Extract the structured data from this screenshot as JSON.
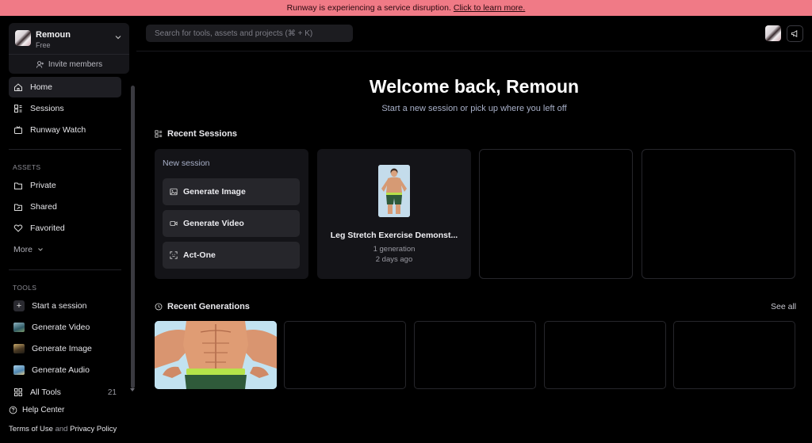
{
  "banner": {
    "text": "Runway is experiencing a service disruption.",
    "link": "Click to learn more."
  },
  "workspace": {
    "name": "Remoun",
    "plan": "Free",
    "invite_label": "Invite members"
  },
  "nav": [
    {
      "label": "Home",
      "icon": "home-icon",
      "active": true
    },
    {
      "label": "Sessions",
      "icon": "sessions-icon"
    },
    {
      "label": "Runway Watch",
      "icon": "tv-icon"
    }
  ],
  "assets": {
    "heading": "ASSETS",
    "items": [
      {
        "label": "Private",
        "icon": "folder-icon"
      },
      {
        "label": "Shared",
        "icon": "shared-folder-icon"
      },
      {
        "label": "Favorited",
        "icon": "heart-icon"
      }
    ],
    "more_label": "More"
  },
  "tools": {
    "heading": "TOOLS",
    "items": [
      {
        "label": "Start a session",
        "icon": "plus-icon"
      },
      {
        "label": "Generate Video",
        "icon": "video-thumb-icon",
        "color": "#4f7f8f"
      },
      {
        "label": "Generate Image",
        "icon": "image-thumb-icon",
        "color": "#6b5a3a"
      },
      {
        "label": "Generate Audio",
        "icon": "audio-thumb-icon",
        "color": "#5f8fb0"
      }
    ],
    "all_tools": {
      "label": "All Tools",
      "count": "21"
    }
  },
  "footer": {
    "help": "Help Center",
    "terms": "Terms of Use",
    "and": "and",
    "privacy": "Privacy Policy"
  },
  "search": {
    "placeholder": "Search for tools, assets and projects (⌘ + K)"
  },
  "main": {
    "welcome": "Welcome back, Remoun",
    "subtitle": "Start a new session or pick up where you left off",
    "recent_sessions_label": "Recent Sessions",
    "new_session": {
      "title": "New session",
      "actions": [
        {
          "label": "Generate Image",
          "icon": "image-icon"
        },
        {
          "label": "Generate Video",
          "icon": "video-camera-icon"
        },
        {
          "label": "Act-One",
          "icon": "face-scan-icon"
        }
      ]
    },
    "session": {
      "title": "Leg Stretch Exercise Demonst...",
      "generations": "1 generation",
      "time": "2 days ago"
    },
    "recent_generations_label": "Recent Generations",
    "see_all": "See all"
  },
  "colors": {
    "banner": "#f07a86",
    "accent_text": "#a8b0c8"
  }
}
